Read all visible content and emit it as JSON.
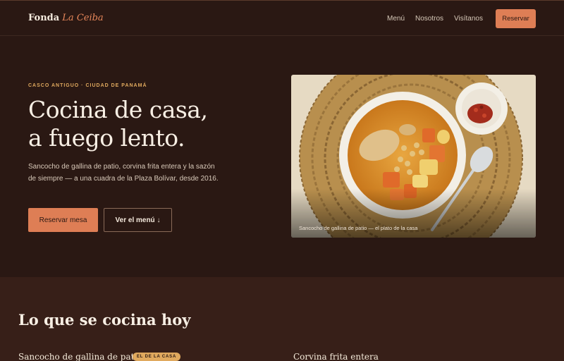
{
  "header": {
    "logo_part1": "Fonda",
    "logo_part2": "La Ceiba",
    "nav": [
      {
        "label": "Menú"
      },
      {
        "label": "Nosotros"
      },
      {
        "label": "Visítanos"
      }
    ],
    "cta_label": "Reservar"
  },
  "hero": {
    "eyebrow": "CASCO ANTIGUO · CIUDAD DE PANAMÁ",
    "headline_line1": "Cocina de casa,",
    "headline_line2": "a fuego lento.",
    "description": "Sancocho de gallina de patio, corvina frita entera y la sazón de siempre — a una cuadra de la Plaza Bolívar, desde 2016.",
    "primary_button": "Reservar mesa",
    "secondary_button": "Ver el menú ↓",
    "image_caption": "Sancocho de gallina de patio — el plato de la casa"
  },
  "menu": {
    "title": "Lo que se cocina hoy",
    "dishes": [
      {
        "name": "Sancocho de gallina de patio",
        "badge": "EL DE LA CASA"
      },
      {
        "name": "Corvina frita entera"
      }
    ]
  },
  "colors": {
    "background": "#2a1813",
    "section_background": "#371f18",
    "accent": "#de7e55",
    "eyebrow": "#e0a95e",
    "text": "#f8efe4"
  }
}
